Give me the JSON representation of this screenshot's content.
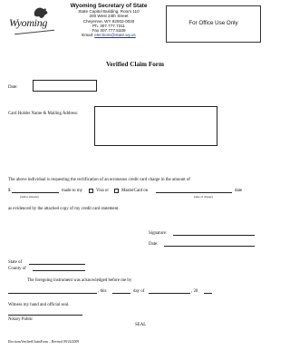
{
  "header": {
    "org_name": "Wyoming Secretary of State",
    "address_line1": "State Capitol Building, Room 110",
    "address_line2": "200 West 24th Street",
    "address_line3": "Cheyenne, WY 82002-0020",
    "phone": "Ph. 307.777.7311",
    "fax": "Fax 307.777.5339",
    "email_label": "Email:",
    "email_value": "elections@state.wy.us",
    "logo_text": "Wyoming"
  },
  "office_box_text": "For Office Use Only",
  "form_title": "Verified Claim Form",
  "labels": {
    "date": "Date:",
    "card_holder": "Card Holder Name & Mailing Address:",
    "request_text": "The above individual is requesting the rectification of an erroneous credit card charge in the amount of",
    "dollar_sign": "$",
    "made_to_my": "made to my",
    "visa_or": "Visa or",
    "mastercard_on": "MasterCard on",
    "date_suffix": "date",
    "dollar_amount_caption": "(dollar amount)",
    "date_of_charge_caption": "(date of charge)",
    "evidenced": "as evidenced by the attached copy of my credit card statement.",
    "signature": "Signature:",
    "date2": "Date:",
    "state_of": "State of",
    "county_of": "County of",
    "acknowledged": "The foregoing instrument was acknowledged before me by",
    "this": ", this",
    "day_of": "day of",
    "year_prefix": ", 20",
    "witness": "Witness my hand and official seal.",
    "notary": "Notary Public",
    "seal": "SEAL"
  },
  "footer": "ElectionsVerifiedClaimForm – Revised 09/24/2009"
}
